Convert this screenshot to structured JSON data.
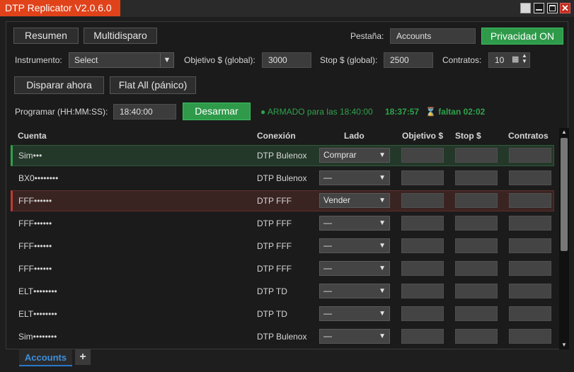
{
  "window": {
    "title": "DTP Replicator V2.0.6.0"
  },
  "toolbar": {
    "resumen_label": "Resumen",
    "multidisparo_label": "Multidisparo",
    "pestana_label": "Pestaña:",
    "pestana_value": "Accounts",
    "privacidad_label": "Privacidad ON"
  },
  "controls": {
    "instrumento_label": "Instrumento:",
    "instrumento_value": "Select",
    "objetivo_label": "Objetivo $ (global):",
    "objetivo_value": "3000",
    "stop_label": "Stop $ (global):",
    "stop_value": "2500",
    "contratos_label": "Contratos:",
    "contratos_value": "10",
    "disparar_label": "Disparar ahora",
    "flat_label": "Flat All (pánico)",
    "programar_label": "Programar (HH:MM:SS):",
    "programar_value": "18:40:00",
    "desarmar_label": "Desarmar",
    "armed_text": "● ARMADO para las 18:40:00",
    "clock": "18:37:57",
    "remaining": "⌛ faltan 02:02"
  },
  "table": {
    "headers": [
      "Cuenta",
      "Conexión",
      "Lado",
      "Objetivo $",
      "Stop $",
      "Contratos"
    ],
    "rows": [
      {
        "cuenta": "Sim•••",
        "conexion": "DTP Bulenox",
        "lado": "Comprar"
      },
      {
        "cuenta": "BX0••••••••",
        "conexion": "DTP Bulenox",
        "lado": "—"
      },
      {
        "cuenta": "FFF••••••",
        "conexion": "DTP FFF",
        "lado": "Vender"
      },
      {
        "cuenta": "FFF••••••",
        "conexion": "DTP FFF",
        "lado": "—"
      },
      {
        "cuenta": "FFF••••••",
        "conexion": "DTP FFF",
        "lado": "—"
      },
      {
        "cuenta": "FFF••••••",
        "conexion": "DTP FFF",
        "lado": "—"
      },
      {
        "cuenta": "ELT••••••••",
        "conexion": "DTP TD",
        "lado": "—"
      },
      {
        "cuenta": "ELT••••••••",
        "conexion": "DTP TD",
        "lado": "—"
      },
      {
        "cuenta": "Sim••••••••",
        "conexion": "DTP Bulenox",
        "lado": "—"
      }
    ]
  },
  "tabs": {
    "active": "Accounts",
    "add": "+"
  },
  "colors": {
    "accent_orange": "#e0421a",
    "green": "#2fa24c",
    "red": "#c23b30",
    "tab_blue": "#3d8fe0"
  }
}
